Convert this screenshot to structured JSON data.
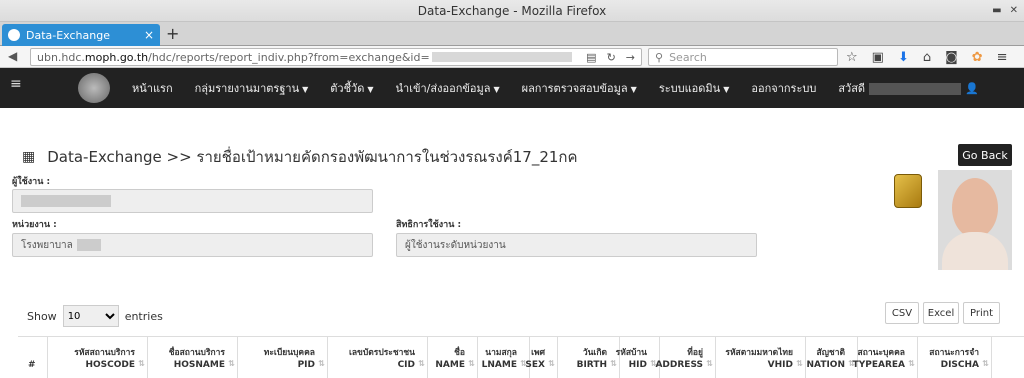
{
  "window": {
    "title": "Data-Exchange - Mozilla Firefox"
  },
  "tab": {
    "title": "Data-Exchange",
    "close": "×",
    "new_tab": "+"
  },
  "navbar": {
    "url_prefix": "ubn.hdc.",
    "url_domain": "moph.go.th",
    "url_rest": "/hdc/reports/report_indiv.php?from=exchange&id=",
    "search_placeholder": "Search"
  },
  "appnav": {
    "menu": [
      "หน้าแรก",
      "กลุ่มรายงานมาตรฐาน",
      "ตัวชี้วัด",
      "นำเข้า/ส่งออกข้อมูล",
      "ผลการตรวจสอบข้อมูล",
      "ระบบแอดมิน",
      "ออกจากระบบ",
      "สวัสดี"
    ]
  },
  "page": {
    "title": "Data-Exchange >> รายชื่อเป้าหมายคัดกรองพัฒนาการในช่วงรณรงค์17_21กค",
    "go_back": "Go Back",
    "user_label": "ผู้ใช้งาน :",
    "unit_label": "หน่วยงาน :",
    "unit_value": "โรงพยาบาล",
    "rights_label": "สิทธิการใช้งาน :",
    "rights_value": "ผู้ใช้งานระดับหน่วยงาน"
  },
  "table_controls": {
    "show": "Show",
    "entries_value": "10",
    "entries": "entries",
    "csv": "CSV",
    "excel": "Excel",
    "print": "Print"
  },
  "table": {
    "columns": [
      {
        "th": "",
        "en": "#"
      },
      {
        "th": "รหัสสถานบริการ",
        "en": "HOSCODE"
      },
      {
        "th": "ชื่อสถานบริการ",
        "en": "HOSNAME"
      },
      {
        "th": "ทะเบียนบุคคล",
        "en": "PID"
      },
      {
        "th": "เลขบัตรประชาชน",
        "en": "CID"
      },
      {
        "th": "ชื่อ",
        "en": "NAME"
      },
      {
        "th": "นามสกุล",
        "en": "LNAME"
      },
      {
        "th": "เพศ",
        "en": "SEX"
      },
      {
        "th": "วันเกิด",
        "en": "BIRTH"
      },
      {
        "th": "รหัสบ้าน",
        "en": "HID"
      },
      {
        "th": "ที่อยู่",
        "en": "ADDRESS"
      },
      {
        "th": "รหัสตามมหาดไทย",
        "en": "VHID"
      },
      {
        "th": "สัญชาติ",
        "en": "NATION"
      },
      {
        "th": "สถานะบุคคล",
        "en": "TYPEAREA"
      },
      {
        "th": "สถานะการจำ",
        "en": "DISCHA"
      }
    ]
  }
}
